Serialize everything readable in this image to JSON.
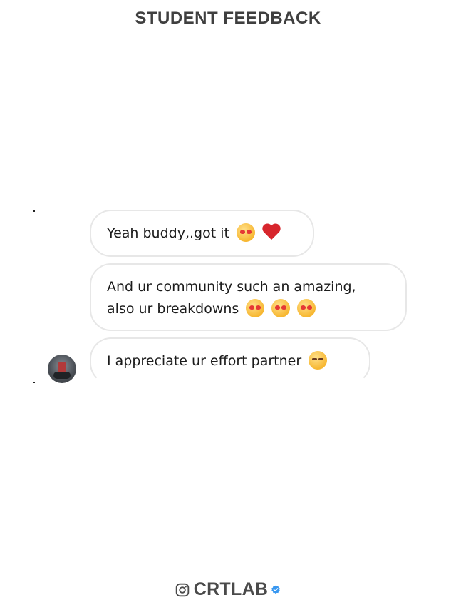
{
  "header": {
    "title": "STUDENT FEEDBACK"
  },
  "messages": [
    {
      "line1": "Yeah buddy,.got it",
      "emojis": [
        "heart-eyes-emoji",
        "red-heart-emoji"
      ]
    },
    {
      "line1": "And ur community such an amazing,",
      "line2": "also ur breakdowns",
      "emojis": [
        "smiling-face-with-hearts-emoji",
        "smiling-face-with-hearts-emoji",
        "smiling-face-with-hearts-emoji"
      ]
    },
    {
      "line1": "I appreciate ur effort partner",
      "emojis": [
        "hugging-face-emoji"
      ]
    }
  ],
  "footer": {
    "brand": "CRTLAB",
    "icons": [
      "instagram-icon",
      "verified-badge-icon"
    ]
  },
  "colors": {
    "title": "#3f3f3f",
    "bubble_border": "#e7e7e7",
    "verified": "#3897f0"
  }
}
